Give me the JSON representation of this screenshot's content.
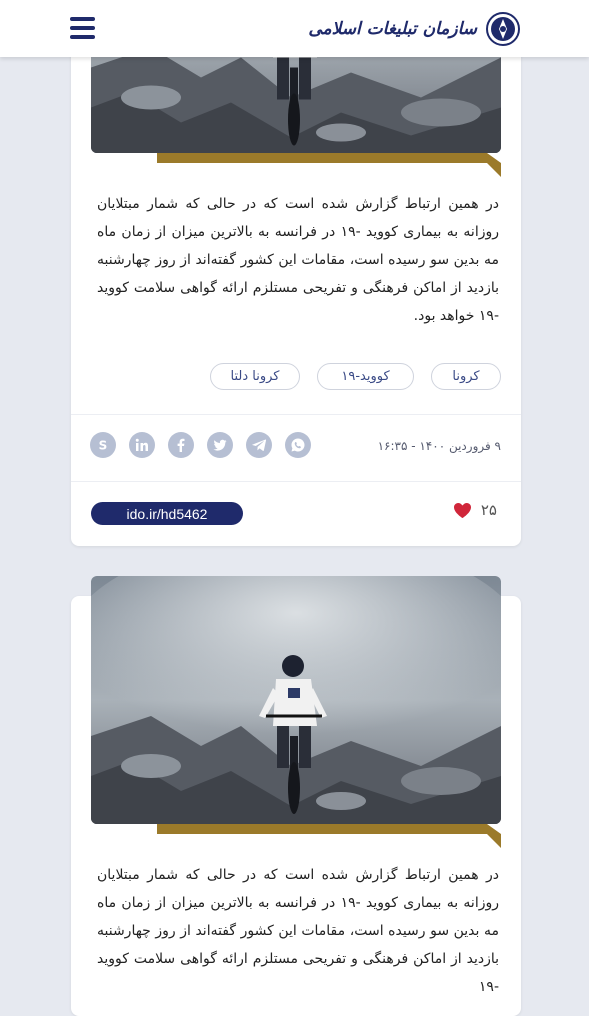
{
  "header": {
    "logo_text": "سازمان تبلیغات اسلامی",
    "menu_icon": "hamburger-menu-icon"
  },
  "colors": {
    "brand": "#1f2a6b",
    "gold": "#9b7a2a",
    "heart": "#d0263a",
    "social": "#b6bfd3"
  },
  "cards": [
    {
      "body": "در همین ارتباط گزارش شده است که در حالی که شمار مبتلایان روزانه به بیماری کووید -۱۹ در فرانسه به بالاترین میزان از زمان ماه مه بدین سو رسیده است، مقامات این کشور گفته‌اند از روز چهارشنبه بازدید از اماکن فرهنگی و تفریحی مستلزم ارائه گواهی سلامت کووید -۱۹ خواهد بود.",
      "tags": [
        "کرونا",
        "کووید-۱۹",
        "کرونا دلتا"
      ],
      "date": "۹ فروردین ۱۴۰۰ - ۱۶:۳۵",
      "short_link": "ido.ir/hd5462",
      "likes": "۲۵",
      "social_icons": [
        "whatsapp-icon",
        "telegram-icon",
        "twitter-icon",
        "facebook-icon",
        "linkedin-icon",
        "skype-icon"
      ]
    },
    {
      "body": "در همین ارتباط گزارش شده است که در حالی که شمار مبتلایان روزانه به بیماری کووید -۱۹ در فرانسه به بالاترین میزان از زمان ماه مه بدین سو رسیده است، مقامات این کشور گفته‌اند از روز چهارشنبه بازدید از اماکن فرهنگی و تفریحی مستلزم ارائه گواهی سلامت کووید -۱۹"
    }
  ]
}
